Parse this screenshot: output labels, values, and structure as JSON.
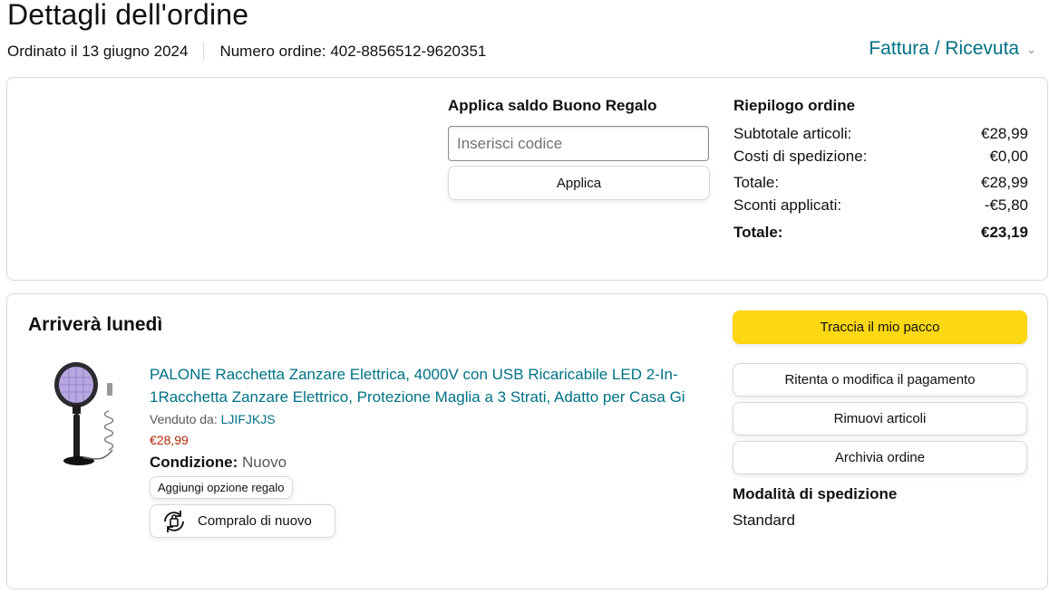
{
  "page_title": "Dettagli dell'ordine",
  "meta": {
    "ordered_on": "Ordinato il 13 giugno 2024",
    "order_number": "Numero ordine: 402-8856512-9620351"
  },
  "invoice_link": "Fattura / Ricevuta",
  "gift_card": {
    "title": "Applica saldo Buono Regalo",
    "placeholder": "Inserisci codice",
    "apply_label": "Applica"
  },
  "summary": {
    "title": "Riepilogo ordine",
    "rows": [
      {
        "label": "Subtotale articoli:",
        "value": "€28,99"
      },
      {
        "label": "Costi di spedizione:",
        "value": "€0,00"
      },
      {
        "label": "Totale:",
        "value": "€28,99"
      },
      {
        "label": "Sconti applicati:",
        "value": "-€5,80"
      }
    ],
    "grand_total_label": "Totale:",
    "grand_total_value": "€23,19"
  },
  "shipment": {
    "arrival": "Arriverà lunedì",
    "product_title": "PALONE Racchetta Zanzare Elettrica, 4000V con USB Ricaricabile LED 2-In-1Racchetta Zanzare Elettrico, Protezione Maglia a 3 Strati, Adatto per Casa Gi",
    "sold_by_label": "Venduto da:",
    "seller": "LJIFJKJS",
    "price": "€28,99",
    "condition_label": "Condizione:",
    "condition_value": "Nuovo",
    "gift_option": "Aggiungi opzione regalo",
    "buy_again": "Compralo di nuovo"
  },
  "actions": {
    "track": "Traccia il mio pacco",
    "retry_payment": "Ritenta o modifica il pagamento",
    "remove_items": "Rimuovi articoli",
    "archive": "Archivia ordine"
  },
  "shipping_method": {
    "title": "Modalità di spedizione",
    "value": "Standard"
  },
  "colors": {
    "link": "#007185",
    "primary_button": "#ffd814",
    "price": "#b12704"
  }
}
